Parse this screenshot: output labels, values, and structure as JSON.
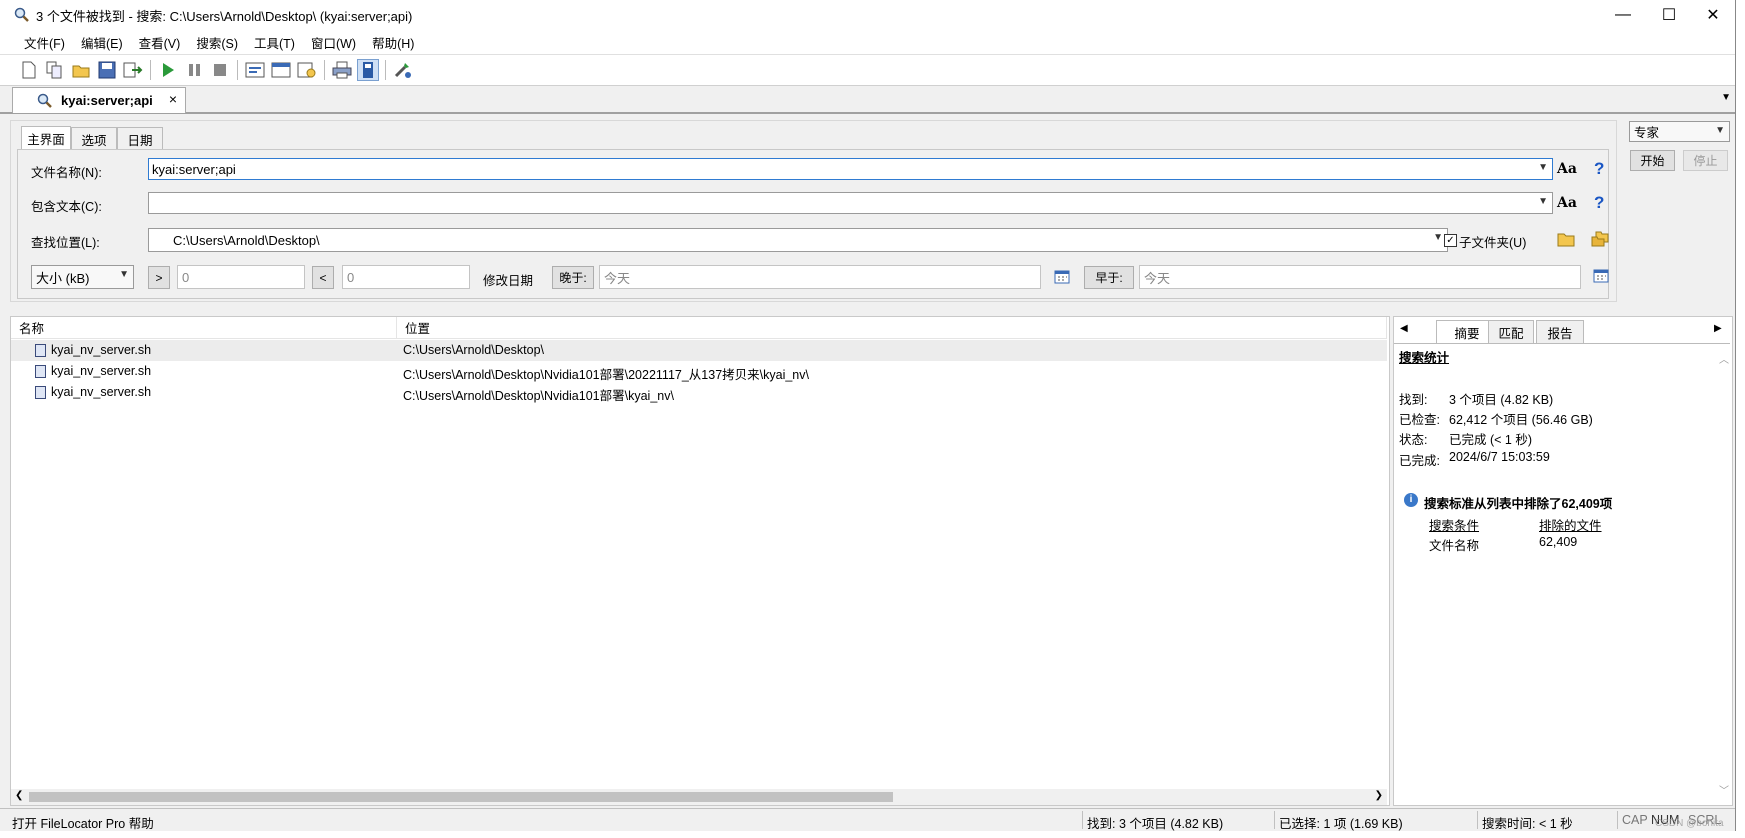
{
  "window": {
    "title": "3 个文件被找到 - 搜索: C:\\Users\\Arnold\\Desktop\\ (kyai:server;api)",
    "minimize": "—",
    "maximize": "☐",
    "close": "✕"
  },
  "menu": [
    "文件(F)",
    "编辑(E)",
    "查看(V)",
    "搜索(S)",
    "工具(T)",
    "窗口(W)",
    "帮助(H)"
  ],
  "toolbar": {
    "icons": [
      "new-icon",
      "copy-icon",
      "open-icon",
      "save-icon",
      "export-icon",
      "start-search-icon",
      "pause-icon",
      "stop-icon",
      "view-1-icon",
      "view-2-icon",
      "view-3-icon",
      "print-icon",
      "book-icon",
      "tools-icon"
    ]
  },
  "doc_tab": {
    "label": "kyai:server;api",
    "close": "×"
  },
  "search_tabs": [
    "主界面",
    "选项",
    "日期"
  ],
  "fields": {
    "filename_label": "文件名称(N):",
    "filename_value": "kyai:server;api",
    "content_label": "包含文本(C):",
    "content_value": "",
    "location_label": "查找位置(L):",
    "location_value": "C:\\Users\\Arnold\\Desktop\\",
    "subfolders_label": "子文件夹(U)",
    "aa": "Aa",
    "help": "?"
  },
  "filters": {
    "size_select": "大小 (kB)",
    "gt": ">",
    "gt_placeholder": "0",
    "lt": "<",
    "lt_placeholder": "0",
    "modified_label": "修改日期",
    "later_btn": "晚于:",
    "later_placeholder": "今天",
    "earlier_btn": "早于:",
    "earlier_placeholder": "今天"
  },
  "controls": {
    "mode": "专家",
    "start": "开始",
    "stop": "停止"
  },
  "results": {
    "columns": [
      "名称",
      "位置"
    ],
    "rows": [
      {
        "name": "kyai_nv_server.sh",
        "location": "C:\\Users\\Arnold\\Desktop\\"
      },
      {
        "name": "kyai_nv_server.sh",
        "location": "C:\\Users\\Arnold\\Desktop\\Nvidia101部署\\20221117_从137拷贝来\\kyai_nv\\"
      },
      {
        "name": "kyai_nv_server.sh",
        "location": "C:\\Users\\Arnold\\Desktop\\Nvidia101部署\\kyai_nv\\"
      }
    ]
  },
  "summary": {
    "tabs": [
      "摘要",
      "匹配",
      "报告"
    ],
    "heading": "搜索统计",
    "stats": [
      {
        "k": "找到:",
        "v": "3 个项目 (4.82 KB)"
      },
      {
        "k": "已检查:",
        "v": "62,412 个项目 (56.46 GB)"
      },
      {
        "k": "状态:",
        "v": "已完成 (< 1 秒)"
      },
      {
        "k": "已完成:",
        "v": "2024/6/7 15:03:59"
      }
    ],
    "excluded_title": "搜索标准从列表中排除了62,409项",
    "excluded_headers": [
      "搜索条件",
      "排除的文件"
    ],
    "excluded_row": [
      "文件名称",
      "62,409"
    ]
  },
  "status": {
    "help": "打开 FileLocator Pro 帮助",
    "found": "找到: 3 个项目 (4.82 KB)",
    "selected": "已选择: 1 项 (1.69 KB)",
    "time": "搜索时间: < 1 秒",
    "cap": "CAP",
    "num": "NUM",
    "scrl": "SCRL",
    "watermark": "CSDN @bonita"
  },
  "colors": {
    "accent": "#2f7bd2",
    "help_blue": "#1a56c4",
    "info_blue": "#3a78c9"
  }
}
